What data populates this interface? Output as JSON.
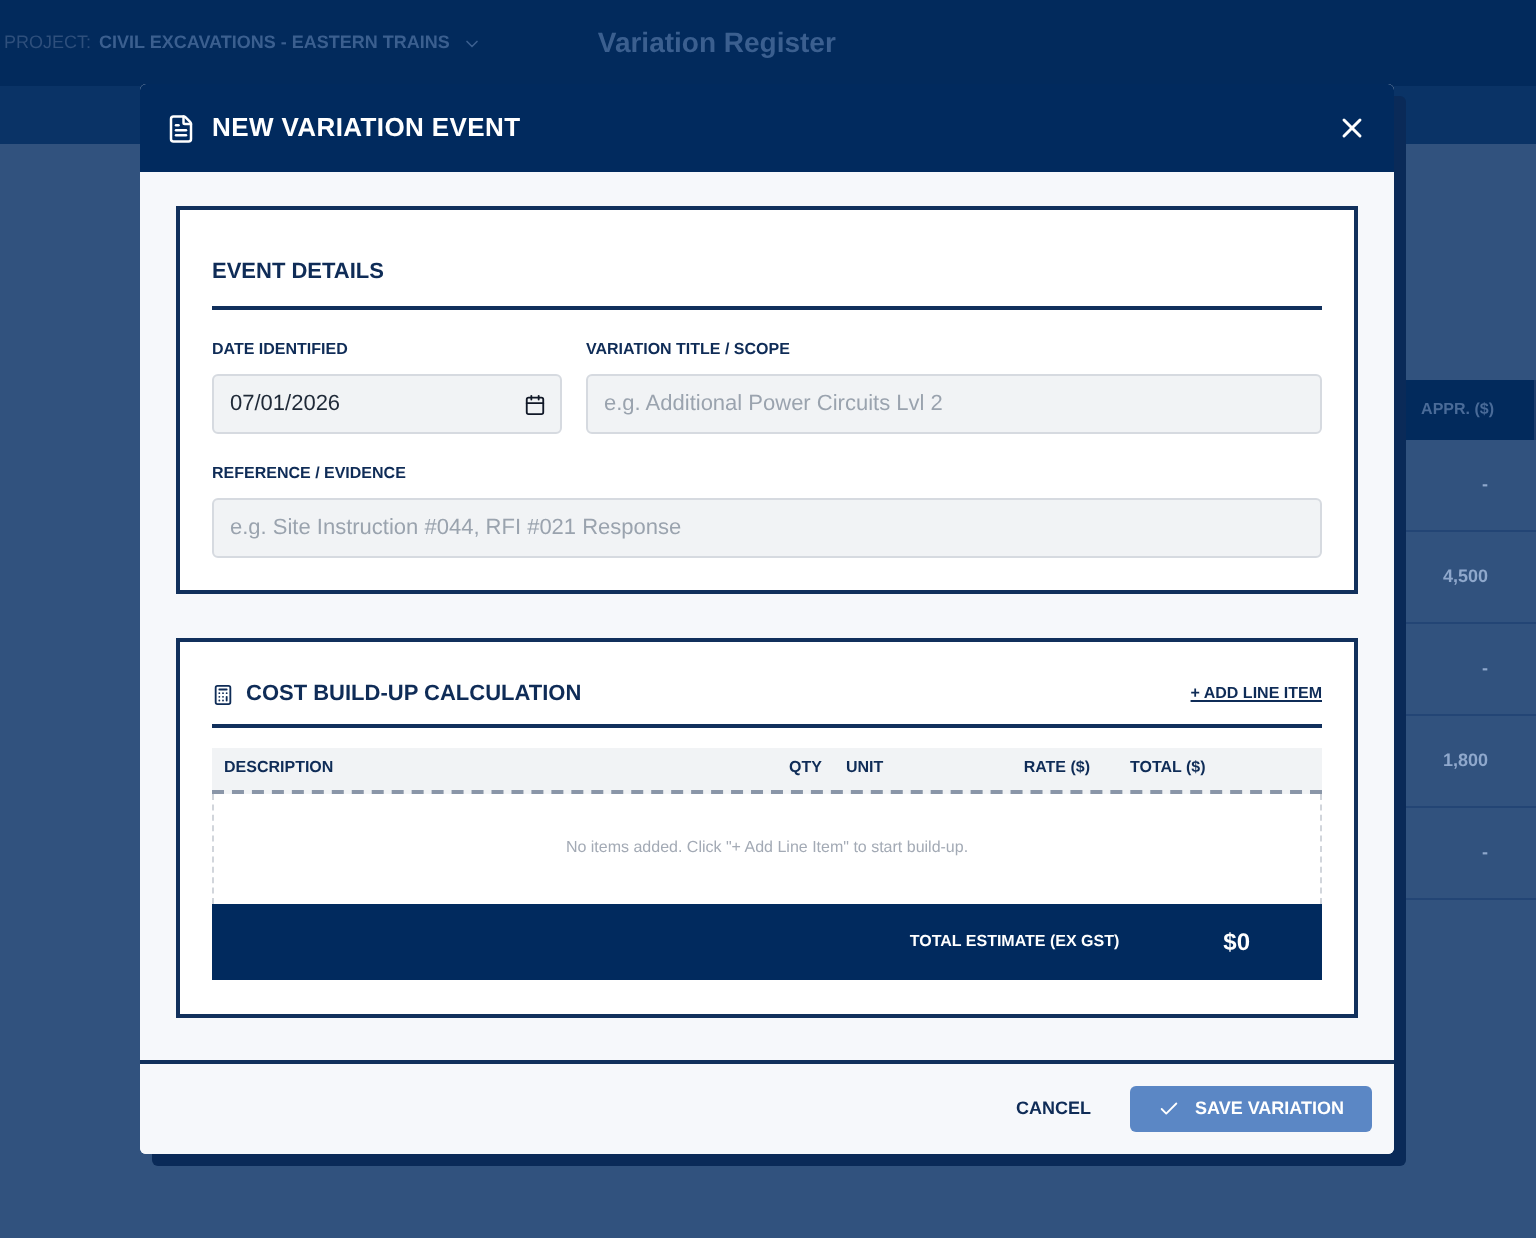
{
  "backdrop": {
    "project_label": "PROJECT:",
    "project_name": "CIVIL EXCAVATIONS - EASTERN TRAINS",
    "page_title": "Variation Register",
    "table": {
      "column_header": "APPR. ($)",
      "rows": [
        "-",
        "4,500",
        "-",
        "1,800",
        "-"
      ]
    }
  },
  "dialog": {
    "title": "NEW VARIATION EVENT",
    "event_details": {
      "heading": "EVENT DETAILS",
      "fields": [
        {
          "label": "DATE IDENTIFIED",
          "kind": "date",
          "value": "07/01/2026"
        },
        {
          "label": "VARIATION TITLE / SCOPE",
          "kind": "text",
          "placeholder": "e.g. Additional Power Circuits Lvl 2"
        },
        {
          "label": "REFERENCE / EVIDENCE",
          "kind": "text",
          "placeholder": "e.g. Site Instruction #044, RFI #021 Response"
        }
      ]
    },
    "cost_buildup": {
      "heading": "COST BUILD-UP CALCULATION",
      "add_link": "+ ADD LINE ITEM",
      "columns": [
        "DESCRIPTION",
        "QTY",
        "UNIT",
        "RATE ($)",
        "TOTAL ($)"
      ],
      "empty_message": "No items added. Click \"+ Add Line Item\" to start build-up.",
      "total_label": "TOTAL ESTIMATE (EX GST)",
      "total_value": "$0"
    },
    "buttons": [
      {
        "label": "CANCEL",
        "kind": "secondary"
      },
      {
        "label": "SAVE VARIATION",
        "kind": "primary"
      }
    ]
  }
}
